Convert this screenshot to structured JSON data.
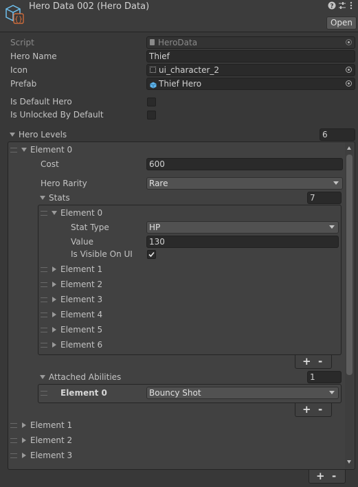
{
  "header": {
    "title": "Hero Data 002 (Hero Data)",
    "open_label": "Open",
    "help_icon": "help-icon",
    "settings_icon": "preset-icon",
    "menu_icon": "kebab-menu-icon"
  },
  "fields": {
    "script_label": "Script",
    "script_value": "HeroData",
    "hero_name_label": "Hero Name",
    "hero_name_value": "Thief",
    "icon_label": "Icon",
    "icon_value": "ui_character_2",
    "prefab_label": "Prefab",
    "prefab_value": "Thief Hero",
    "is_default_label": "Is Default Hero",
    "is_default_checked": false,
    "is_unlocked_label": "Is Unlocked By Default",
    "is_unlocked_checked": false
  },
  "hero_levels": {
    "label": "Hero Levels",
    "count": "6",
    "element0": {
      "label": "Element 0",
      "cost_label": "Cost",
      "cost_value": "600",
      "rarity_label": "Hero Rarity",
      "rarity_value": "Rare",
      "stats": {
        "label": "Stats",
        "count": "7",
        "element0": {
          "label": "Element 0",
          "stat_type_label": "Stat Type",
          "stat_type_value": "HP",
          "value_label": "Value",
          "value_value": "130",
          "visible_label": "Is Visible On UI",
          "visible_checked": true
        },
        "collapsed": [
          "Element 1",
          "Element 2",
          "Element 3",
          "Element 4",
          "Element 5",
          "Element 6"
        ]
      },
      "abilities": {
        "label": "Attached Abilities",
        "count": "1",
        "element0_label": "Element 0",
        "element0_value": "Bouncy Shot"
      }
    },
    "collapsed": [
      "Element 1",
      "Element 2",
      "Element 3"
    ]
  },
  "plus": "+",
  "minus": "-"
}
